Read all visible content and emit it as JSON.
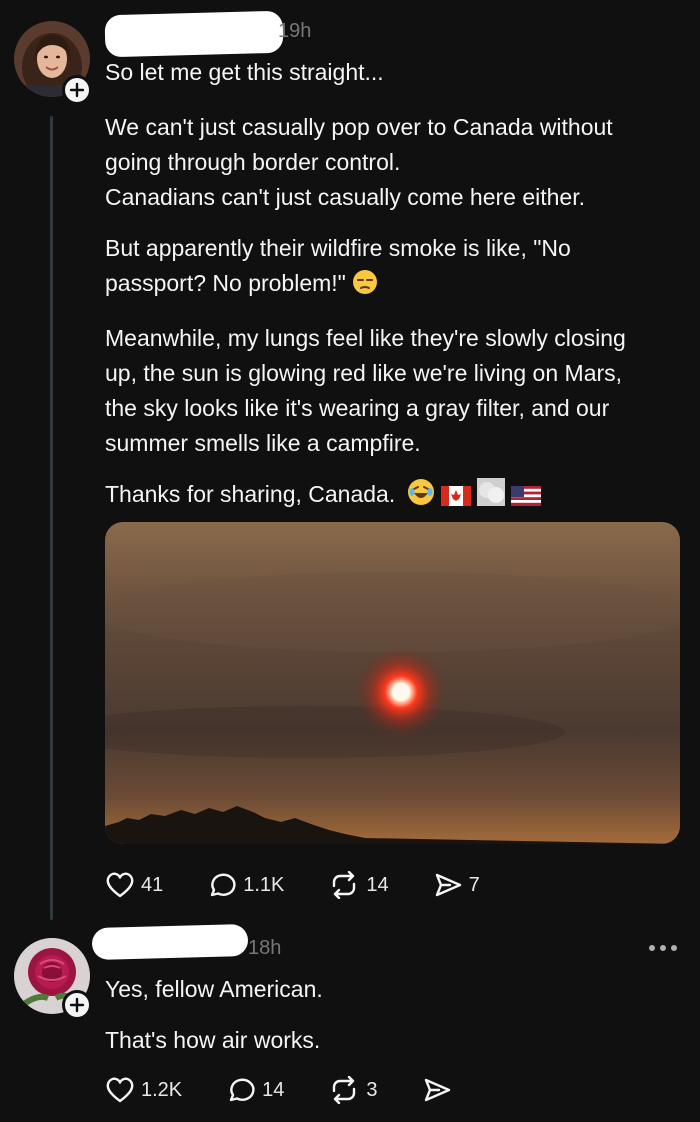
{
  "post": {
    "timestamp": "19h",
    "lines": [
      "So let me get this straight...",
      "We can't just casually pop over to Canada without",
      "going through border control.",
      "Canadians can't just casually come here either.",
      "But apparently their wildfire smoke is like, \"No",
      "passport? No problem!\"",
      "Meanwhile, my lungs feel like they're slowly closing",
      "up, the sun is glowing red like we're living on Mars,",
      "the sky looks like it's wearing a gray filter, and our",
      "summer smells like a campfire.",
      "Thanks for sharing, Canada."
    ],
    "actions": {
      "likes": "41",
      "replies": "1.1K",
      "reposts": "14",
      "shares": "7"
    }
  },
  "reply": {
    "timestamp": "18h",
    "lines": [
      "Yes, fellow American.",
      "That's how air works."
    ],
    "actions": {
      "likes": "1.2K",
      "replies": "14",
      "reposts": "3"
    }
  },
  "icons": {
    "like": "heart-icon",
    "reply": "comment-icon",
    "repost": "repost-icon",
    "share": "send-icon",
    "more": "more-dots-icon",
    "follow": "plus-icon"
  },
  "colors": {
    "background": "#101010",
    "text": "#f3f5f7",
    "muted": "#777777",
    "thread_line": "#2f3a3e"
  }
}
